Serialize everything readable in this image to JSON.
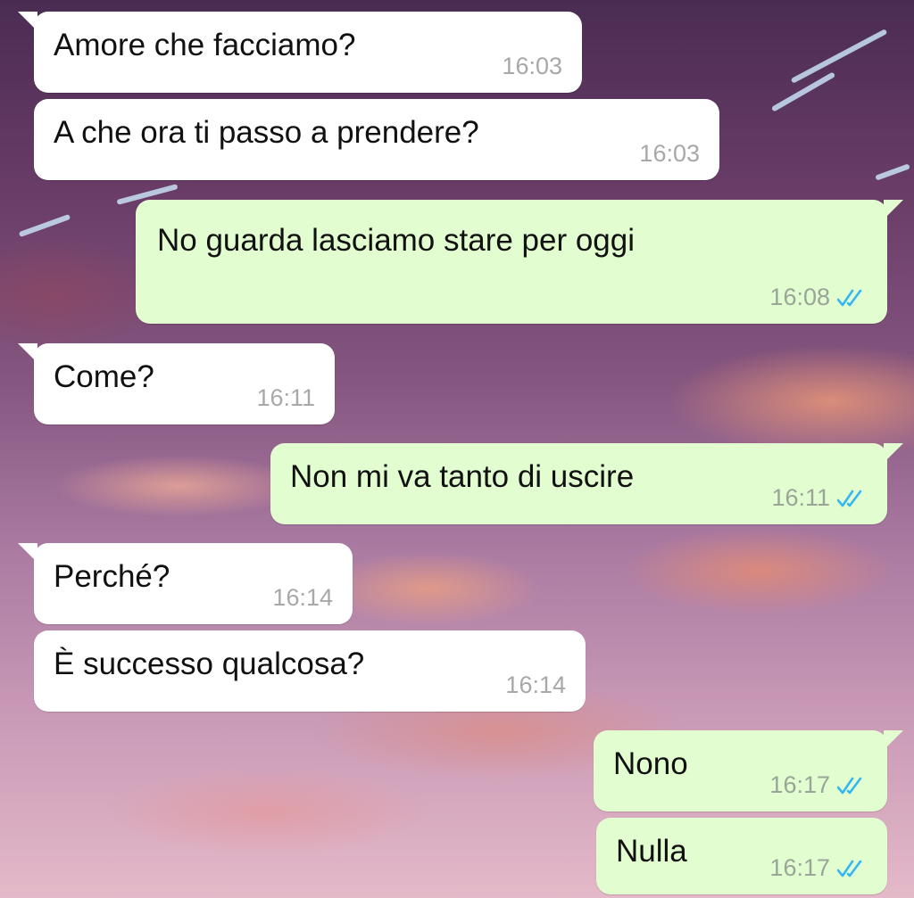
{
  "chat": {
    "messages": [
      {
        "direction": "in",
        "text": "Amore che facciamo?",
        "time": "16:03"
      },
      {
        "direction": "in",
        "text": "A che ora ti passo a prendere?",
        "time": "16:03"
      },
      {
        "direction": "out",
        "text": "No guarda lasciamo stare per oggi",
        "time": "16:08",
        "status": "read"
      },
      {
        "direction": "in",
        "text": "Come?",
        "time": "16:11"
      },
      {
        "direction": "out",
        "text": "Non mi va tanto di uscire",
        "time": "16:11",
        "status": "read"
      },
      {
        "direction": "in",
        "text": "Perché?",
        "time": "16:14"
      },
      {
        "direction": "in",
        "text": "È successo qualcosa?",
        "time": "16:14"
      },
      {
        "direction": "out",
        "text": "Nono",
        "time": "16:17",
        "status": "read"
      },
      {
        "direction": "out",
        "text": "Nulla",
        "time": "16:17",
        "status": "read"
      }
    ]
  },
  "icons": {
    "read_receipt": "double-check-icon"
  },
  "colors": {
    "incoming_bubble": "#ffffff",
    "outgoing_bubble": "#e2fdcf",
    "read_check": "#34b7f1",
    "timestamp": "#a8a8a8"
  }
}
